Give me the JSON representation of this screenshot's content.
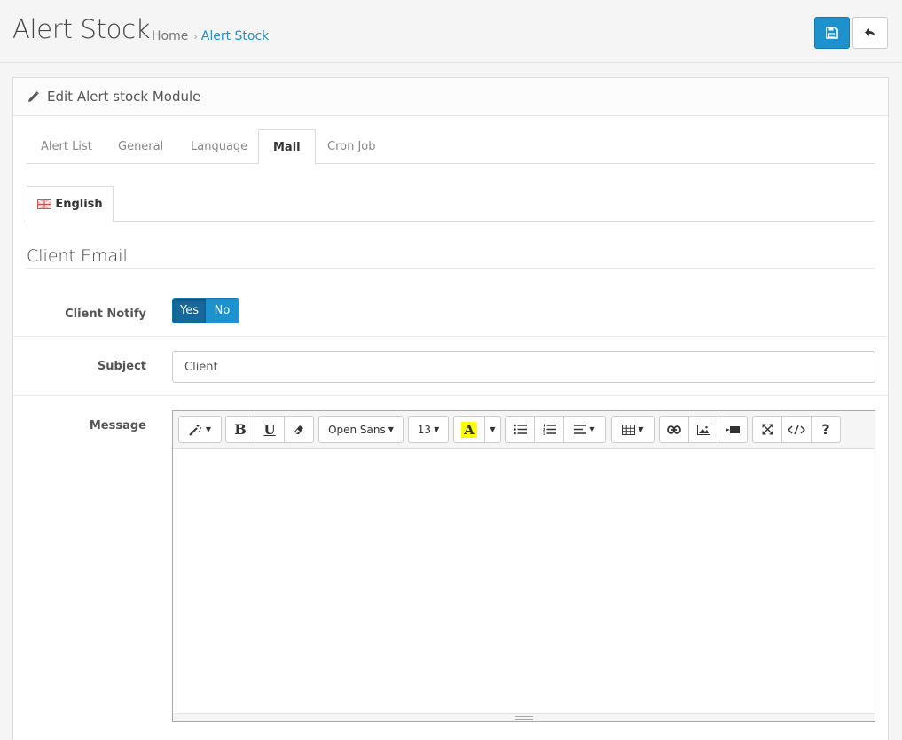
{
  "header": {
    "title": "Alert Stock",
    "breadcrumb": [
      {
        "label": "Home"
      },
      {
        "label": "Alert Stock"
      }
    ],
    "save_icon": "save-icon",
    "back_icon": "reply-icon"
  },
  "panel": {
    "heading": "Edit Alert stock Module",
    "heading_icon": "pencil-icon"
  },
  "tabs": [
    {
      "label": "Alert List"
    },
    {
      "label": "General"
    },
    {
      "label": "Language"
    },
    {
      "label": "Mail",
      "active": true
    },
    {
      "label": "Cron Job"
    }
  ],
  "language_tab": {
    "label": "English",
    "icon": "uk-flag-icon"
  },
  "section_title": "Client Email",
  "client_notify": {
    "label": "Client Notify",
    "options": [
      "Yes",
      "No"
    ],
    "selected": "Yes"
  },
  "subject": {
    "label": "Subject",
    "value": "Client"
  },
  "message": {
    "label": "Message",
    "toolbar": {
      "font_name": "Open Sans",
      "font_size": "13",
      "bold": "B",
      "underline": "U",
      "color_letter": "A",
      "help": "?"
    }
  },
  "colors": {
    "primary": "#1e91cf",
    "primary_dark": "#17689b",
    "highlight": "#ffff00"
  }
}
